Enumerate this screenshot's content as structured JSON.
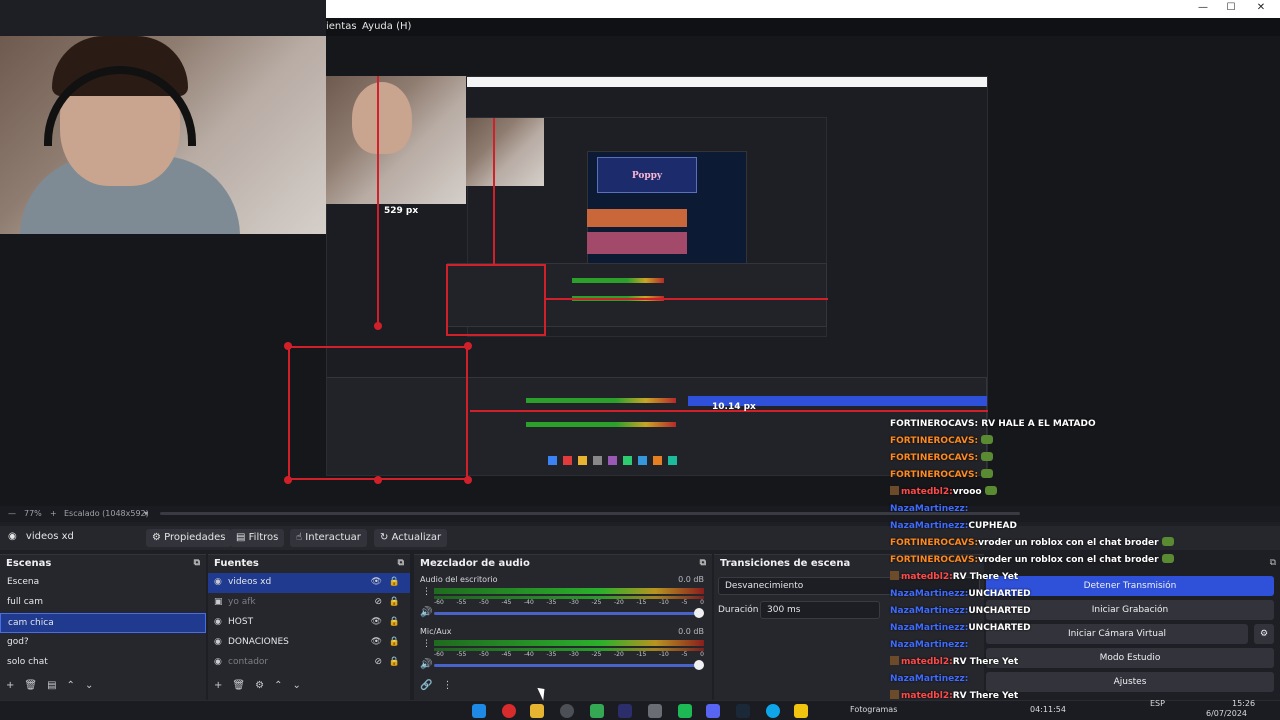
{
  "menu": {
    "tools_partial": "ientas",
    "help": "Ayuda (H)"
  },
  "preview": {
    "px_label_1": "529 px",
    "px_label_2": "10.14 px",
    "game_title": "Poppy",
    "nested_chat_frag": "RV HALE A EL MATADO"
  },
  "status": {
    "zoom": "77%",
    "scale": "Escalado (1048x592)"
  },
  "context_bar": {
    "source_name": "videos xd",
    "properties": "Propiedades",
    "filters": "Filtros",
    "interact": "Interactuar",
    "refresh": "Actualizar"
  },
  "scenes": {
    "title": "Escenas",
    "items": [
      "Escena",
      "full cam",
      "cam chica",
      "god?",
      "solo chat"
    ],
    "selected_index": 2
  },
  "sources": {
    "title": "Fuentes",
    "items": [
      {
        "label": "videos xd",
        "icon": "monitor-icon",
        "visible": true,
        "selected": true
      },
      {
        "label": "yo afk",
        "icon": "image-icon",
        "visible": false
      },
      {
        "label": "HOST",
        "icon": "monitor-icon",
        "visible": true
      },
      {
        "label": "DONACIONES",
        "icon": "monitor-icon",
        "visible": true
      },
      {
        "label": "contador",
        "icon": "monitor-icon",
        "visible": false
      }
    ]
  },
  "mixer": {
    "title": "Mezclador de audio",
    "channels": [
      {
        "name": "Audio del escritorio",
        "db": "0.0 dB"
      },
      {
        "name": "Mic/Aux",
        "db": "0.0 dB"
      }
    ],
    "ticks": [
      "-60",
      "-55",
      "-50",
      "-45",
      "-40",
      "-35",
      "-30",
      "-25",
      "-20",
      "-15",
      "-10",
      "-5",
      "0"
    ]
  },
  "transitions": {
    "title": "Transiciones de escena",
    "type": "Desvanecimiento",
    "duration_label": "Duración",
    "duration_value": "300 ms"
  },
  "controls": {
    "stop_stream": "Detener Transmisión",
    "start_recording": "Iniciar Grabación",
    "virtual_cam": "Iniciar Cámara Virtual",
    "studio_mode": "Modo Estudio",
    "settings": "Ajustes"
  },
  "chat": [
    {
      "user": "",
      "msg": "FORTINEROCAVS: RV HALE A EL MATADO",
      "color": "orange",
      "badge": false
    },
    {
      "user": "FORTINEROCAVS:",
      "msg": "",
      "color": "orange",
      "badge": false,
      "emote": true
    },
    {
      "user": "FORTINEROCAVS:",
      "msg": "",
      "color": "orange",
      "badge": false,
      "emote": true
    },
    {
      "user": "FORTINEROCAVS:",
      "msg": "",
      "color": "orange",
      "badge": false,
      "emote": true
    },
    {
      "user": "matedbl2:",
      "msg": "vrooo",
      "color": "red",
      "badge": true,
      "emote": true
    },
    {
      "user": "NazaMartinezz:",
      "msg": "",
      "color": "blue",
      "badge": false
    },
    {
      "user": "NazaMartinezz:",
      "msg": "CUPHEAD",
      "color": "blue",
      "badge": false
    },
    {
      "user": "FORTINEROCAVS:",
      "msg": "vroder un roblox con el chat broder",
      "color": "orange",
      "badge": false,
      "emote": true
    },
    {
      "user": "FORTINEROCAVS:",
      "msg": "vroder un roblox con el chat broder",
      "color": "orange",
      "badge": false,
      "emote": true
    },
    {
      "user": "matedbl2:",
      "msg": "RV There Yet",
      "color": "red",
      "badge": true
    },
    {
      "user": "NazaMartinezz:",
      "msg": "UNCHARTED",
      "color": "blue",
      "badge": false
    },
    {
      "user": "NazaMartinezz:",
      "msg": "UNCHARTED",
      "color": "blue",
      "badge": false
    },
    {
      "user": "NazaMartinezz:",
      "msg": "UNCHARTED",
      "color": "blue",
      "badge": false
    },
    {
      "user": "NazaMartinezz:",
      "msg": "",
      "color": "blue",
      "badge": false
    },
    {
      "user": "matedbl2:",
      "msg": "RV There Yet",
      "color": "red",
      "badge": true
    },
    {
      "user": "NazaMartinezz:",
      "msg": "",
      "color": "blue",
      "badge": false
    },
    {
      "user": "matedbl2:",
      "msg": "RV There Yet",
      "color": "red",
      "badge": true
    }
  ],
  "taskbar": {
    "bottom_text": "Fotogramas",
    "time_stream": "04:11:54",
    "lang": "ESP",
    "clock_time": "15:26",
    "clock_date": "6/07/2024"
  },
  "colors": {
    "accent": "#2f50d8",
    "selection": "#1f3a8f",
    "red_guides": "#d1202a"
  }
}
